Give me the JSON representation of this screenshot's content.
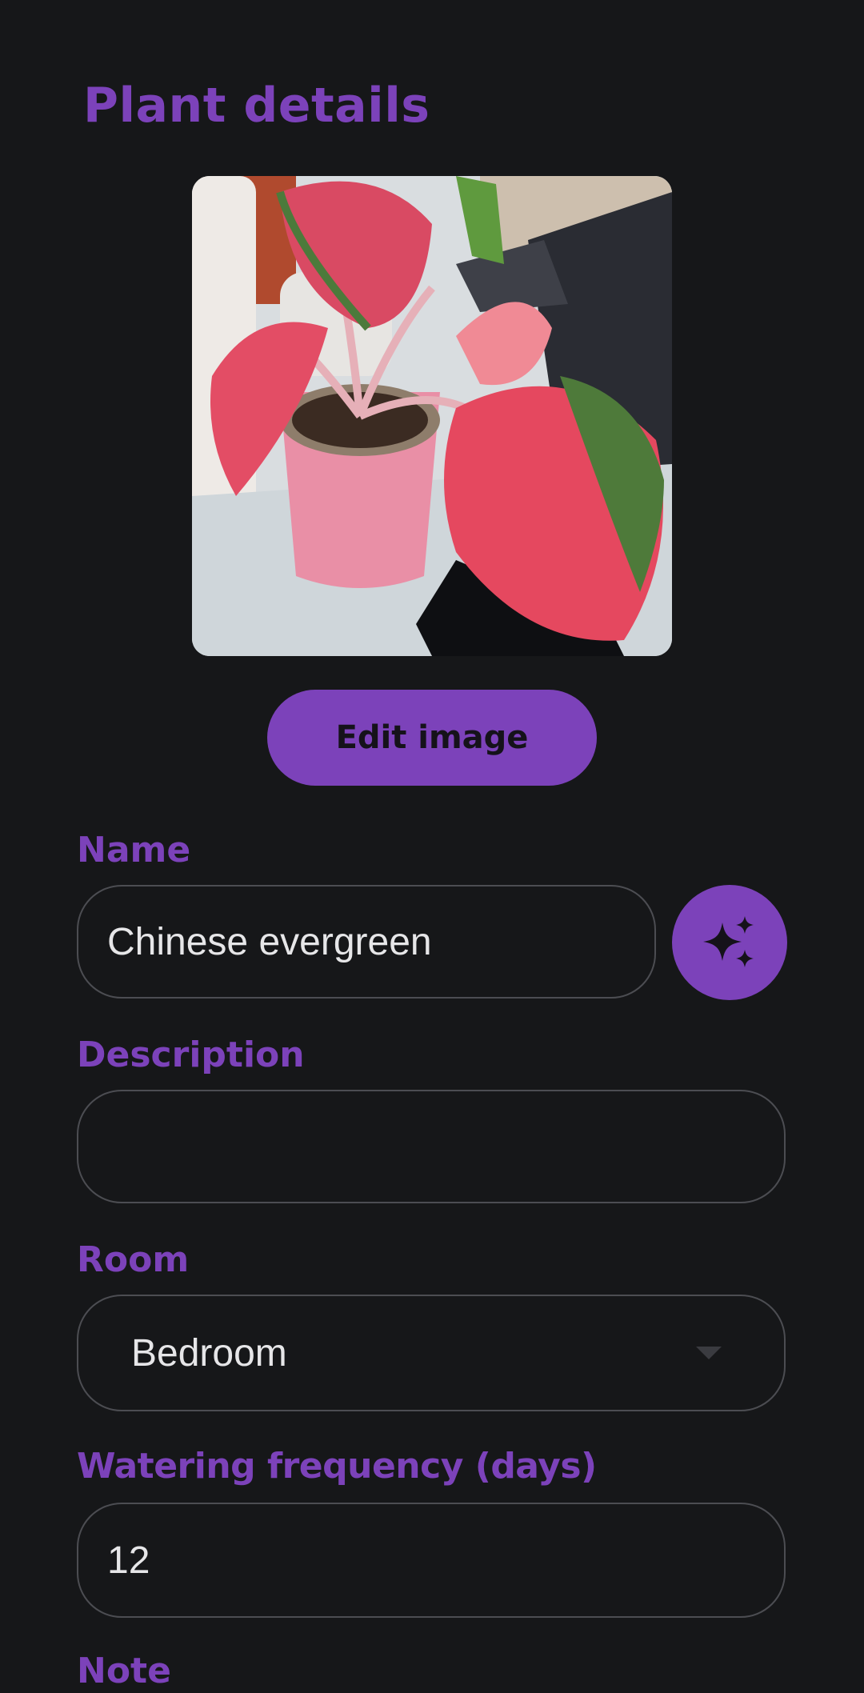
{
  "header": {
    "title": "Plant details"
  },
  "image": {
    "alt": "Chinese evergreen plant photo",
    "edit_label": "Edit image"
  },
  "fields": {
    "name": {
      "label": "Name",
      "value": "Chinese evergreen"
    },
    "description": {
      "label": "Description",
      "value": ""
    },
    "room": {
      "label": "Room",
      "value": "Bedroom"
    },
    "watering": {
      "label": "Watering frequency (days)",
      "value": "12"
    },
    "note": {
      "label": "Note"
    }
  },
  "icons": {
    "magic": "sparkles-icon",
    "dropdown": "chevron-down-icon"
  },
  "colors": {
    "accent": "#7c42ba",
    "background": "#161719",
    "border": "#4c4d52",
    "text": "#e6e6e8"
  }
}
